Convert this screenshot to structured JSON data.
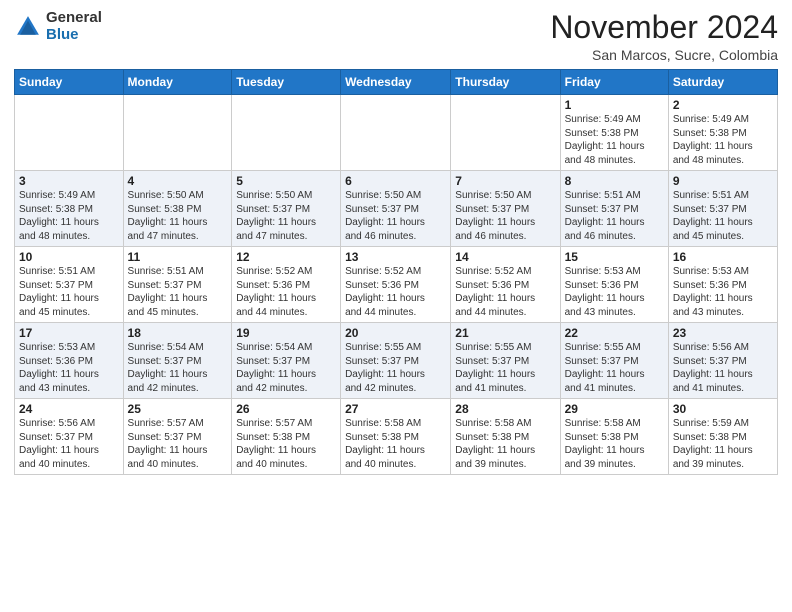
{
  "header": {
    "logo_line1": "General",
    "logo_line2": "Blue",
    "month": "November 2024",
    "location": "San Marcos, Sucre, Colombia"
  },
  "weekdays": [
    "Sunday",
    "Monday",
    "Tuesday",
    "Wednesday",
    "Thursday",
    "Friday",
    "Saturday"
  ],
  "weeks": [
    [
      {
        "day": "",
        "info": ""
      },
      {
        "day": "",
        "info": ""
      },
      {
        "day": "",
        "info": ""
      },
      {
        "day": "",
        "info": ""
      },
      {
        "day": "",
        "info": ""
      },
      {
        "day": "1",
        "info": "Sunrise: 5:49 AM\nSunset: 5:38 PM\nDaylight: 11 hours\nand 48 minutes."
      },
      {
        "day": "2",
        "info": "Sunrise: 5:49 AM\nSunset: 5:38 PM\nDaylight: 11 hours\nand 48 minutes."
      }
    ],
    [
      {
        "day": "3",
        "info": "Sunrise: 5:49 AM\nSunset: 5:38 PM\nDaylight: 11 hours\nand 48 minutes."
      },
      {
        "day": "4",
        "info": "Sunrise: 5:50 AM\nSunset: 5:38 PM\nDaylight: 11 hours\nand 47 minutes."
      },
      {
        "day": "5",
        "info": "Sunrise: 5:50 AM\nSunset: 5:37 PM\nDaylight: 11 hours\nand 47 minutes."
      },
      {
        "day": "6",
        "info": "Sunrise: 5:50 AM\nSunset: 5:37 PM\nDaylight: 11 hours\nand 46 minutes."
      },
      {
        "day": "7",
        "info": "Sunrise: 5:50 AM\nSunset: 5:37 PM\nDaylight: 11 hours\nand 46 minutes."
      },
      {
        "day": "8",
        "info": "Sunrise: 5:51 AM\nSunset: 5:37 PM\nDaylight: 11 hours\nand 46 minutes."
      },
      {
        "day": "9",
        "info": "Sunrise: 5:51 AM\nSunset: 5:37 PM\nDaylight: 11 hours\nand 45 minutes."
      }
    ],
    [
      {
        "day": "10",
        "info": "Sunrise: 5:51 AM\nSunset: 5:37 PM\nDaylight: 11 hours\nand 45 minutes."
      },
      {
        "day": "11",
        "info": "Sunrise: 5:51 AM\nSunset: 5:37 PM\nDaylight: 11 hours\nand 45 minutes."
      },
      {
        "day": "12",
        "info": "Sunrise: 5:52 AM\nSunset: 5:36 PM\nDaylight: 11 hours\nand 44 minutes."
      },
      {
        "day": "13",
        "info": "Sunrise: 5:52 AM\nSunset: 5:36 PM\nDaylight: 11 hours\nand 44 minutes."
      },
      {
        "day": "14",
        "info": "Sunrise: 5:52 AM\nSunset: 5:36 PM\nDaylight: 11 hours\nand 44 minutes."
      },
      {
        "day": "15",
        "info": "Sunrise: 5:53 AM\nSunset: 5:36 PM\nDaylight: 11 hours\nand 43 minutes."
      },
      {
        "day": "16",
        "info": "Sunrise: 5:53 AM\nSunset: 5:36 PM\nDaylight: 11 hours\nand 43 minutes."
      }
    ],
    [
      {
        "day": "17",
        "info": "Sunrise: 5:53 AM\nSunset: 5:36 PM\nDaylight: 11 hours\nand 43 minutes."
      },
      {
        "day": "18",
        "info": "Sunrise: 5:54 AM\nSunset: 5:37 PM\nDaylight: 11 hours\nand 42 minutes."
      },
      {
        "day": "19",
        "info": "Sunrise: 5:54 AM\nSunset: 5:37 PM\nDaylight: 11 hours\nand 42 minutes."
      },
      {
        "day": "20",
        "info": "Sunrise: 5:55 AM\nSunset: 5:37 PM\nDaylight: 11 hours\nand 42 minutes."
      },
      {
        "day": "21",
        "info": "Sunrise: 5:55 AM\nSunset: 5:37 PM\nDaylight: 11 hours\nand 41 minutes."
      },
      {
        "day": "22",
        "info": "Sunrise: 5:55 AM\nSunset: 5:37 PM\nDaylight: 11 hours\nand 41 minutes."
      },
      {
        "day": "23",
        "info": "Sunrise: 5:56 AM\nSunset: 5:37 PM\nDaylight: 11 hours\nand 41 minutes."
      }
    ],
    [
      {
        "day": "24",
        "info": "Sunrise: 5:56 AM\nSunset: 5:37 PM\nDaylight: 11 hours\nand 40 minutes."
      },
      {
        "day": "25",
        "info": "Sunrise: 5:57 AM\nSunset: 5:37 PM\nDaylight: 11 hours\nand 40 minutes."
      },
      {
        "day": "26",
        "info": "Sunrise: 5:57 AM\nSunset: 5:38 PM\nDaylight: 11 hours\nand 40 minutes."
      },
      {
        "day": "27",
        "info": "Sunrise: 5:58 AM\nSunset: 5:38 PM\nDaylight: 11 hours\nand 40 minutes."
      },
      {
        "day": "28",
        "info": "Sunrise: 5:58 AM\nSunset: 5:38 PM\nDaylight: 11 hours\nand 39 minutes."
      },
      {
        "day": "29",
        "info": "Sunrise: 5:58 AM\nSunset: 5:38 PM\nDaylight: 11 hours\nand 39 minutes."
      },
      {
        "day": "30",
        "info": "Sunrise: 5:59 AM\nSunset: 5:38 PM\nDaylight: 11 hours\nand 39 minutes."
      }
    ]
  ]
}
